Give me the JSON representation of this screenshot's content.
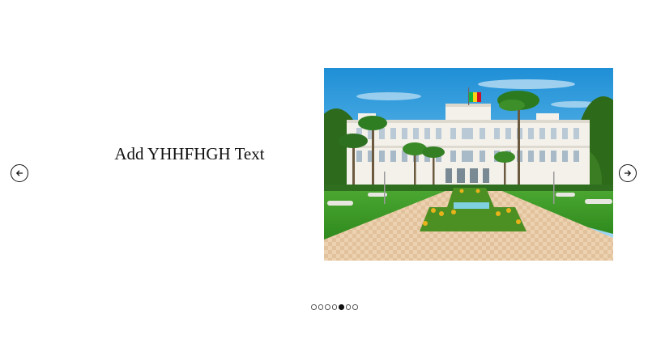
{
  "slide": {
    "caption": "Add YHHFHGH Text",
    "image_icon": "palace-photo"
  },
  "navigation": {
    "prev_icon": "arrow-left-icon",
    "next_icon": "arrow-right-icon"
  },
  "pagination": {
    "total": 7,
    "active_index": 4
  },
  "colors": {
    "sky": "#2a9ad8",
    "lawn": "#3f9a2a",
    "building": "#f2f0ea",
    "path": "#e8c8a8",
    "text": "#111111"
  }
}
